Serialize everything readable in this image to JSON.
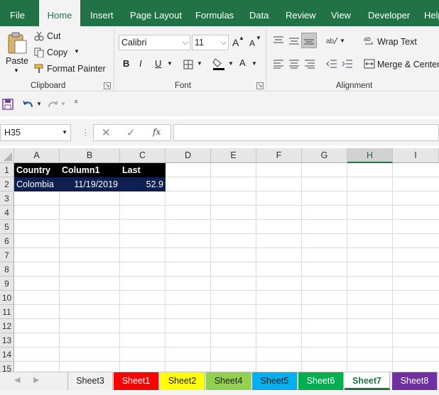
{
  "ribbon_tabs": [
    "File",
    "Home",
    "Insert",
    "Page Layout",
    "Formulas",
    "Data",
    "Review",
    "View",
    "Developer",
    "Help"
  ],
  "active_tab": "Home",
  "clipboard": {
    "paste": "Paste",
    "cut": "Cut",
    "copy": "Copy",
    "format_painter": "Format Painter",
    "group_label": "Clipboard"
  },
  "font": {
    "name": "Calibri",
    "size": "11",
    "group_label": "Font",
    "bold": "B",
    "italic": "I",
    "underline": "U",
    "grow": "A",
    "shrink": "A",
    "color_a": "A"
  },
  "alignment": {
    "wrap_text": "Wrap Text",
    "merge_center": "Merge & Center",
    "group_label": "Alignment"
  },
  "name_box": "H35",
  "formula_value": "",
  "fx_label": "fx",
  "columns": [
    "A",
    "B",
    "C",
    "D",
    "E",
    "F",
    "G",
    "H",
    "I"
  ],
  "selected_column": "H",
  "rows": [
    "1",
    "2",
    "3",
    "4",
    "5",
    "6",
    "7",
    "8",
    "9",
    "10",
    "11",
    "12",
    "13",
    "14",
    "15"
  ],
  "table": {
    "headers": [
      "Country",
      "Column1",
      "Last"
    ],
    "row": [
      "Colombia",
      "11/19/2019",
      "52.9"
    ]
  },
  "sheet_tabs": [
    {
      "name": "Sheet3",
      "color": "#f0f0f0"
    },
    {
      "name": "Sheet1",
      "color": "#ff0000"
    },
    {
      "name": "Sheet2",
      "color": "#ffff00"
    },
    {
      "name": "Sheet4",
      "color": "#92d050"
    },
    {
      "name": "Sheet5",
      "color": "#00b0f0"
    },
    {
      "name": "Sheet6",
      "color": "#00b050"
    },
    {
      "name": "Sheet7",
      "color": "#ffffff"
    },
    {
      "name": "Sheet8",
      "color": "#7030a0"
    }
  ],
  "active_sheet": "Sheet7",
  "colors": {
    "accent": "#217346",
    "header_fill": "#000000",
    "data_fill": "#0e1f50"
  }
}
